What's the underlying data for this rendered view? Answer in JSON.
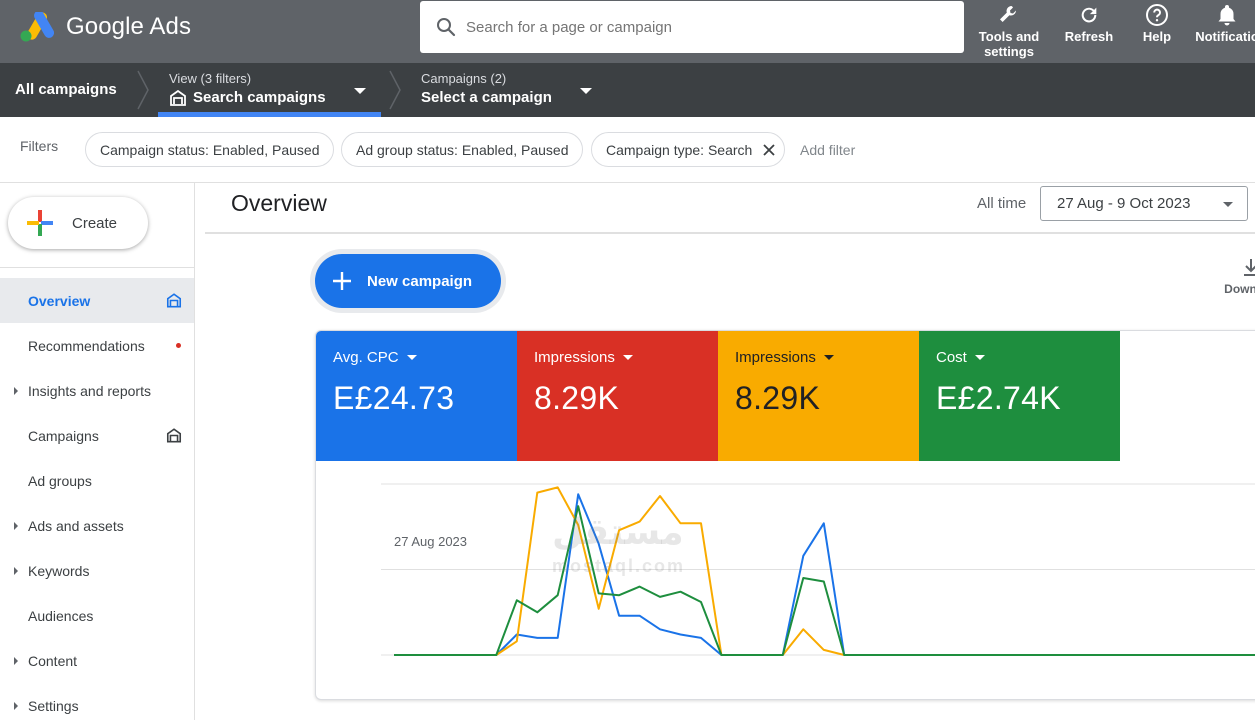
{
  "topbar": {
    "brand": "Google Ads",
    "search_placeholder": "Search for a page or campaign",
    "buttons": {
      "tools": "Tools and\nsettings",
      "refresh": "Refresh",
      "help": "Help",
      "notifications": "Notificatio"
    }
  },
  "navbar": {
    "all_campaigns": "All campaigns",
    "view_small": "View (3 filters)",
    "view_big": "Search campaigns",
    "campaigns_small": "Campaigns (2)",
    "campaigns_big": "Select a campaign"
  },
  "filters": {
    "label": "Filters",
    "chips": [
      "Campaign status: Enabled, Paused",
      "Ad group status: Enabled, Paused",
      "Campaign type: Search"
    ],
    "add": "Add filter"
  },
  "sidebar": {
    "create": "Create",
    "items": [
      {
        "label": "Overview",
        "active": true,
        "expand": false,
        "badge": "home"
      },
      {
        "label": "Recommendations",
        "active": false,
        "expand": false,
        "badge": "dot"
      },
      {
        "label": "Insights and reports",
        "active": false,
        "expand": true,
        "badge": ""
      },
      {
        "label": "Campaigns",
        "active": false,
        "expand": false,
        "badge": "home"
      },
      {
        "label": "Ad groups",
        "active": false,
        "expand": false,
        "badge": ""
      },
      {
        "label": "Ads and assets",
        "active": false,
        "expand": true,
        "badge": ""
      },
      {
        "label": "Keywords",
        "active": false,
        "expand": true,
        "badge": ""
      },
      {
        "label": "Audiences",
        "active": false,
        "expand": false,
        "badge": ""
      },
      {
        "label": "Content",
        "active": false,
        "expand": true,
        "badge": ""
      },
      {
        "label": "Settings",
        "active": false,
        "expand": true,
        "badge": ""
      }
    ]
  },
  "main": {
    "title": "Overview",
    "all_time": "All time",
    "date_range": "27 Aug - 9 Oct 2023",
    "new_campaign": "New campaign",
    "download": "Down"
  },
  "metrics": [
    {
      "name": "Avg. CPC",
      "value": "E£24.73",
      "color": "#1a73e8",
      "text": "#ffffff"
    },
    {
      "name": "Impressions",
      "value": "8.29K",
      "color": "#d93025",
      "text": "#ffffff"
    },
    {
      "name": "Impressions",
      "value": "8.29K",
      "color": "#f9ab00",
      "text": "#202124"
    },
    {
      "name": "Cost",
      "value": "E£2.74K",
      "color": "#1e8e3e",
      "text": "#ffffff"
    }
  ],
  "watermark": {
    "line1": "مستقل",
    "line2": "mostaql.com"
  },
  "chart_data": {
    "type": "line",
    "x_start_label": "27 Aug 2023",
    "ylim": [
      0,
      100
    ],
    "grid": true,
    "series": [
      {
        "color": "#1a73e8",
        "values": [
          0,
          0,
          0,
          0,
          0,
          0,
          12,
          10,
          10,
          94,
          65,
          23,
          23,
          15,
          12,
          10,
          0,
          0,
          0,
          0,
          58,
          77,
          0,
          0,
          0,
          0,
          0,
          0,
          0,
          0,
          0,
          0,
          0,
          0,
          0,
          0,
          0,
          0,
          0,
          0,
          0,
          0,
          0,
          0
        ]
      },
      {
        "color": "#f9ab00",
        "values": [
          0,
          0,
          0,
          0,
          0,
          0,
          8,
          95,
          98,
          76,
          27,
          73,
          78,
          93,
          77,
          77,
          0,
          0,
          0,
          0,
          15,
          3,
          0,
          0,
          0,
          0,
          0,
          0,
          0,
          0,
          0,
          0,
          0,
          0,
          0,
          0,
          0,
          0,
          0,
          0,
          0,
          0,
          0,
          0
        ]
      },
      {
        "color": "#1e8e3e",
        "values": [
          0,
          0,
          0,
          0,
          0,
          0,
          32,
          25,
          35,
          87,
          36,
          35,
          40,
          34,
          37,
          31,
          0,
          0,
          0,
          0,
          45,
          43,
          0,
          0,
          0,
          0,
          0,
          0,
          0,
          0,
          0,
          0,
          0,
          0,
          0,
          0,
          0,
          0,
          0,
          0,
          0,
          0,
          0,
          0
        ]
      }
    ]
  }
}
